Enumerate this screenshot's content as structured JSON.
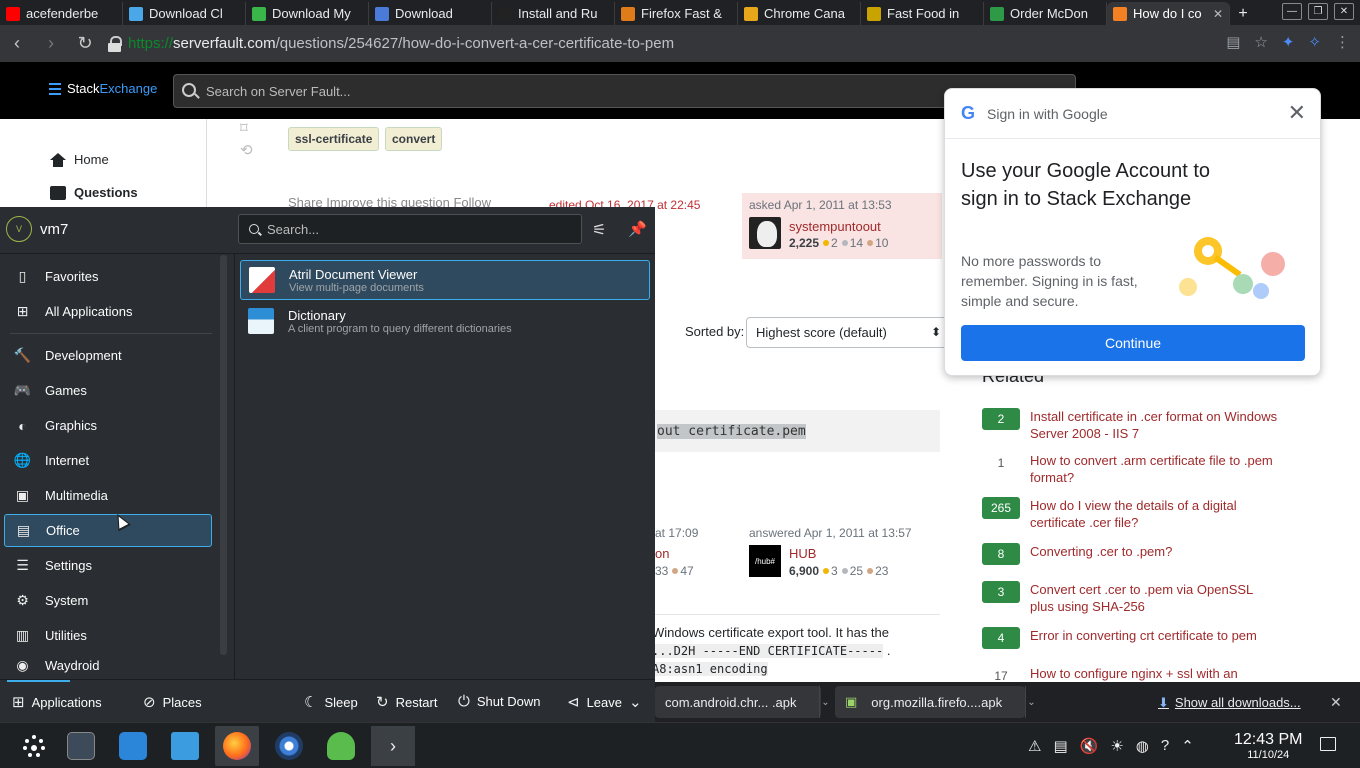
{
  "browser": {
    "tabs": [
      {
        "title": "acefenderbe",
        "color": "#ff0000"
      },
      {
        "title": "Download Cl",
        "color": "#4aa8e8"
      },
      {
        "title": "Download My",
        "color": "#39b54a"
      },
      {
        "title": "Download",
        "color": "#4a7bd8"
      },
      {
        "title": "Install and Ru",
        "color": "#222222"
      },
      {
        "title": "Firefox Fast &",
        "color": "#e07b1a"
      },
      {
        "title": "Chrome Cana",
        "color": "#e8a61a"
      },
      {
        "title": "Fast Food in",
        "color": "#c9a400"
      },
      {
        "title": "Order McDon",
        "color": "#2e9a48"
      },
      {
        "title": "How do I co",
        "color": "#f48024"
      }
    ],
    "new_tab_icon": "plus-icon",
    "url_scheme": "https://",
    "url_host": "serverfault.com",
    "url_path": "/questions/254627/how-do-i-convert-a-cer-certificate-to-pem"
  },
  "stackexchange": {
    "logo_left": "Stack",
    "logo_right": "Exchange",
    "search_placeholder": "Search on Server Fault...",
    "nav": [
      {
        "label": "Home",
        "icon": "home-icon"
      },
      {
        "label": "Questions",
        "icon": "questions-icon"
      }
    ],
    "tags": [
      "ssl-certificate",
      "convert"
    ],
    "question_actions": "Share  Improve this question  Follow",
    "edited": "edited Oct 16, 2017 at 22:45",
    "asked": {
      "when": "asked Apr 1, 2011 at 13:53",
      "user": "systempuntoout",
      "reputation": "2,225",
      "gold": "2",
      "silver": "14",
      "bronze": "10"
    },
    "sorted_label": "Sorted by:",
    "sorted_value": "Highest score (default)",
    "code_snippet": "out certificate.pem",
    "answer_left": {
      "at": "at 17:09",
      "user": "on",
      "silver": "33",
      "bronze": "47"
    },
    "answered": {
      "when": "answered Apr 1, 2011 at 13:57",
      "user": "HUB",
      "reputation": "6,900",
      "gold": "3",
      "silver": "25",
      "bronze": "23",
      "avatar_text": "/hub#"
    },
    "body_line1": "Windows certificate export tool. It has the",
    "body_line2": "...D2H -----END CERTIFICATE-----",
    "body_line2_suffix": ".",
    "body_line3": "A8:asn1 encoding",
    "related_title": "Related",
    "related": [
      {
        "score": "2",
        "title": "Install certificate in .cer format on Windows Server 2008 - IIS 7",
        "accepted": true
      },
      {
        "score": "1",
        "title": "How to convert .arm certificate file to .pem format?",
        "accepted": false
      },
      {
        "score": "265",
        "title": "How do I view the details of a digital certificate .cer file?",
        "accepted": true
      },
      {
        "score": "8",
        "title": "Converting .cer to .pem?",
        "accepted": true
      },
      {
        "score": "3",
        "title": "Convert cert .cer to .pem via OpenSSL plus using SHA-256",
        "accepted": true
      },
      {
        "score": "4",
        "title": "Error in converting crt certificate to pem",
        "accepted": true
      },
      {
        "score": "17",
        "title": "How to configure nginx + ssl with an",
        "accepted": false
      }
    ]
  },
  "google_signin": {
    "header": "Sign in with Google",
    "title": "Use your Google Account to sign in to Stack Exchange",
    "subtitle": "No more passwords to remember. Signing in is fast, simple and secure.",
    "button": "Continue"
  },
  "launcher": {
    "user": "vm7",
    "user_initial": "V",
    "search_placeholder": "Search...",
    "categories": [
      {
        "label": "Favorites",
        "icon": "bookmark-icon",
        "selected": false
      },
      {
        "label": "All Applications",
        "icon": "grid-icon",
        "selected": false
      },
      {
        "label": "Development",
        "icon": "development-icon",
        "selected": false
      },
      {
        "label": "Games",
        "icon": "gamepad-icon",
        "selected": false
      },
      {
        "label": "Graphics",
        "icon": "graphics-icon",
        "selected": false
      },
      {
        "label": "Internet",
        "icon": "globe-icon",
        "selected": false
      },
      {
        "label": "Multimedia",
        "icon": "multimedia-icon",
        "selected": false
      },
      {
        "label": "Office",
        "icon": "office-icon",
        "selected": true
      },
      {
        "label": "Settings",
        "icon": "settings-sliders-icon",
        "selected": false
      },
      {
        "label": "System",
        "icon": "gear-icon",
        "selected": false
      },
      {
        "label": "Utilities",
        "icon": "toolbox-icon",
        "selected": false
      },
      {
        "label": "Waydroid",
        "icon": "android-icon",
        "selected": false
      }
    ],
    "apps": [
      {
        "name": "Atril Document Viewer",
        "desc": "View multi-page documents",
        "selected": true
      },
      {
        "name": "Dictionary",
        "desc": "A client program to query different dictionaries",
        "selected": false
      }
    ],
    "bottom": {
      "applications": "Applications",
      "places": "Places",
      "sleep": "Sleep",
      "restart": "Restart",
      "shutdown": "Shut Down",
      "leave": "Leave"
    }
  },
  "downloads": {
    "items": [
      "com.android.chr... .apk",
      "org.mozilla.firefo....apk"
    ],
    "show_all": "Show all downloads..."
  },
  "taskbar": {
    "time": "12:43 PM",
    "date": "11/10/24"
  }
}
